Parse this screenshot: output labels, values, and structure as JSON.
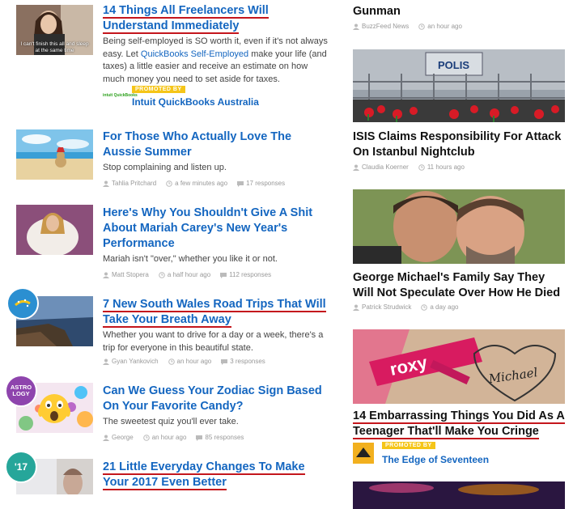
{
  "left_articles": [
    {
      "title": "14 Things All Freelancers Will Understand Immediately",
      "thumb_caption": "I can't finish this all and sleep at the same time",
      "desc_before": "Being self-employed is SO worth it, even if it's not always easy. Let ",
      "desc_link": "QuickBooks Self-Employed",
      "desc_after": " make your life (and taxes) a little easier and receive an estimate on how much money you need to set aside for taxes.",
      "badge": "PROMOTED BY",
      "sponsor": "Intuit QuickBooks Australia",
      "sponsor_logo_text": "intuit QuickBooks"
    },
    {
      "title": "For Those Who Actually Love The Aussie Summer",
      "desc": "Stop complaining and listen up.",
      "author": "Tahlia Pritchard",
      "time": "a few minutes ago",
      "responses": "17 responses"
    },
    {
      "title": "Here's Why You Shouldn't Give A Shit About Mariah Carey's New Year's Performance",
      "desc": "Mariah isn't \"over,\" whether you like it or not.",
      "author": "Matt Stopera",
      "time": "a half hour ago",
      "responses": "112 responses"
    },
    {
      "title": "7 New South Wales Road Trips That Will Take Your Breath Away",
      "desc": "Whether you want to drive for a day or a week, there's a trip for everyone in this beautiful state.",
      "author": "Gyan Yankovich",
      "time": "an hour ago",
      "responses": "3 responses"
    },
    {
      "title": "Can We Guess Your Zodiac Sign Based On Your Favorite Candy?",
      "desc": "The sweetest quiz you'll ever take.",
      "author": "George",
      "time": "an hour ago",
      "responses": "85 responses",
      "badge_text": "ASTRO LOGY"
    },
    {
      "title": "21 Little Everyday Changes To Make Your 2017 Even Better",
      "badge_text": "'17"
    }
  ],
  "right_articles": [
    {
      "title": "Gunman",
      "author": "BuzzFeed News",
      "time": "an hour ago"
    },
    {
      "title": "ISIS Claims Responsibility For Attack On Istanbul Nightclub",
      "author": "Claudia Koerner",
      "time": "11 hours ago",
      "image_sign": "POLIS"
    },
    {
      "title": "George Michael's Family Say They Will Not Speculate Over How He Died",
      "author": "Patrick Strudwick",
      "time": "a day ago"
    },
    {
      "title_u1": "14 Embarrassing Things You Did As A",
      "title_u2": "Teenager That'll Make You Cringe",
      "badge": "PROMOTED BY",
      "sponsor": "The Edge of Seventeen",
      "image_text_1": "roxy",
      "image_text_2": "Michael"
    }
  ],
  "colors": {
    "link_blue": "#1466c0",
    "underline_red": "#c4161c",
    "badge_yellow": "#f5c518"
  },
  "icons": [
    "user-icon",
    "clock-icon",
    "comment-icon"
  ]
}
